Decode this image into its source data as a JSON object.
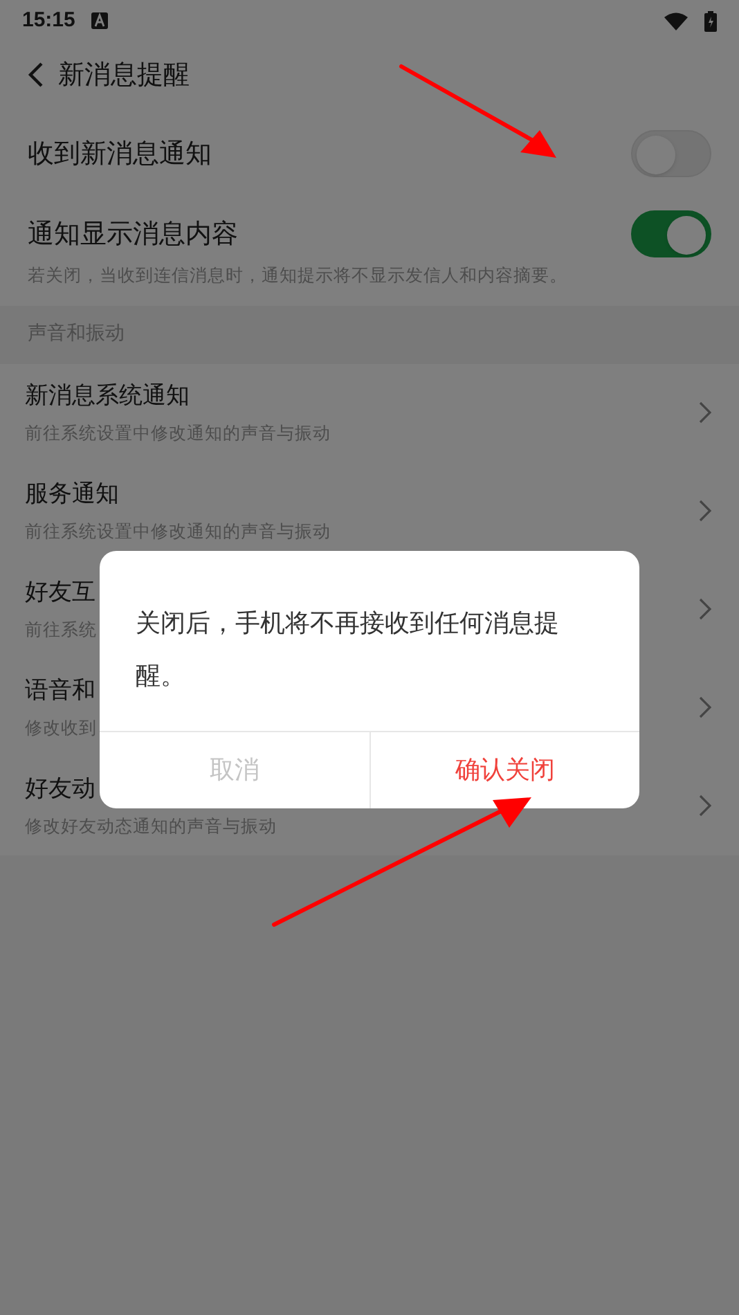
{
  "status_bar": {
    "time": "15:15"
  },
  "header": {
    "title": "新消息提醒"
  },
  "toggles": [
    {
      "label": "收到新消息通知",
      "on": false
    },
    {
      "label": "通知显示消息内容",
      "on": true,
      "description": "若关闭，当收到连信消息时，通知提示将不显示发信人和内容摘要。"
    }
  ],
  "section": {
    "title": "声音和振动"
  },
  "items": [
    {
      "title": "新消息系统通知",
      "subtitle": "前往系统设置中修改通知的声音与振动"
    },
    {
      "title": "服务通知",
      "subtitle": "前往系统设置中修改通知的声音与振动"
    },
    {
      "title": "好友互",
      "subtitle": "前往系统"
    },
    {
      "title": "语音和",
      "subtitle": "修改收到"
    },
    {
      "title": "好友动",
      "subtitle": "修改好友动态通知的声音与振动"
    }
  ],
  "dialog": {
    "message": "关闭后，手机将不再接收到任何消息提醒。",
    "buttons": [
      {
        "label": "取消",
        "kind": "cancel"
      },
      {
        "label": "确认关闭",
        "kind": "confirm"
      }
    ]
  }
}
